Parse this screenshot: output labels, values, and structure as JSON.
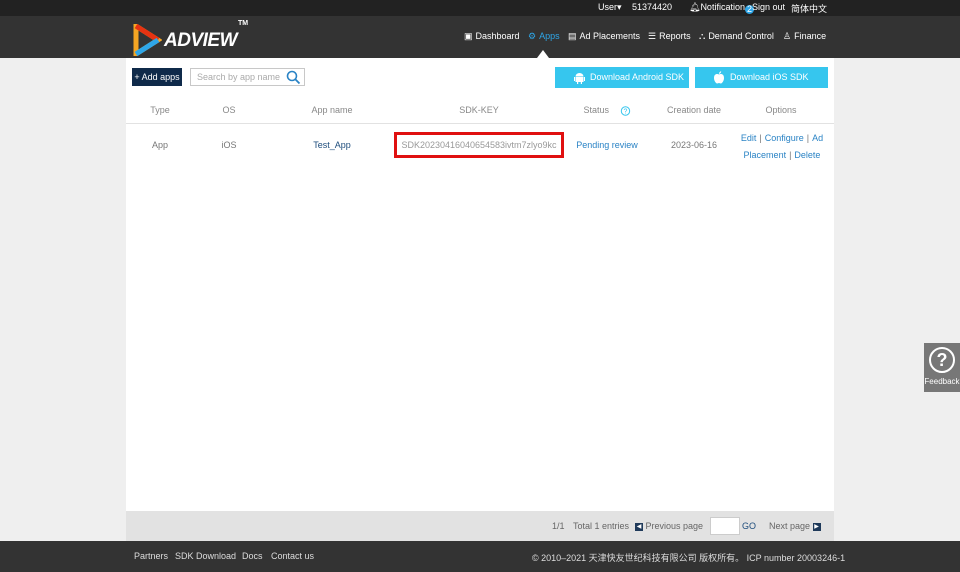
{
  "topbar": {
    "user_label": "User",
    "user_id": "51374420",
    "notification_label": "Notification",
    "notification_count": "2",
    "signout_label": "Sign out",
    "language_label": "简体中文"
  },
  "header": {
    "logo_text": "ADVIEW",
    "logo_tm": "TM",
    "nav": {
      "dashboard": "Dashboard",
      "apps": "Apps",
      "ad_placements": "Ad Placements",
      "reports": "Reports",
      "demand_control": "Demand Control",
      "finance": "Finance"
    },
    "active_nav": "Apps"
  },
  "toolbar": {
    "add_apps_label": "+ Add apps",
    "search_placeholder": "Search by app name",
    "download_android_label": "Download Android SDK",
    "download_ios_label": "Download iOS SDK"
  },
  "table": {
    "columns": {
      "type": "Type",
      "os": "OS",
      "app_name": "App name",
      "sdk_key": "SDK-KEY",
      "status": "Status",
      "creation_date": "Creation date",
      "options": "Options"
    },
    "rows": [
      {
        "type": "App",
        "os": "iOS",
        "app_name": "Test_App",
        "sdk_key": "SDK20230416040654583ivtm7zlyo9kc",
        "status": "Pending review",
        "creation_date": "2023-06-16",
        "options": {
          "edit": "Edit",
          "configure": "Configure",
          "ad_placement": "Ad Placement",
          "delete": "Delete"
        }
      }
    ]
  },
  "pagination": {
    "page_indicator": "1/1",
    "total_entries": "Total 1 entries",
    "previous_label": "Previous page",
    "go_label": "GO",
    "next_label": "Next page"
  },
  "footer": {
    "links": {
      "partners": "Partners",
      "sdk_download": "SDK Download",
      "docs": "Docs",
      "contact_us": "Contact us"
    },
    "copyright": "© 2010–2021 天津快友世纪科技有限公司 版权所有。 ICP number 20003246-1"
  },
  "feedback": {
    "label": "Feedback"
  },
  "colors": {
    "header_bg": "#333333",
    "accent": "#2ea6e8",
    "sdk_button": "#36c6ee",
    "highlight_border": "#e01010",
    "add_button": "#0f2a4a"
  }
}
